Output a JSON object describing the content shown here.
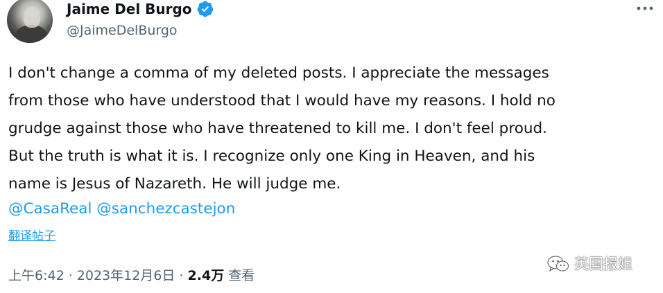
{
  "author": {
    "display_name": "Jaime Del Burgo",
    "handle": "@JaimeDelBurgo",
    "verified": true,
    "verified_color": "#1d9bf0"
  },
  "tweet": {
    "lines": [
      "I don't change a comma of my deleted posts. I appreciate the messages",
      "from those who have understood that I would have my reasons. I hold no",
      "grudge against those who have threatened to kill me. I don't feel proud.",
      "But the truth is what it is. I recognize only one King in Heaven, and his",
      "name is Jesus of Nazareth. He will judge me."
    ],
    "mentions": [
      "@CasaReal",
      "@sanchezcastejon"
    ],
    "translate_label": "翻译帖子"
  },
  "meta": {
    "time": "上午6:42",
    "separator": " · ",
    "date": "2023年12月6日",
    "views_count": "2.4万",
    "views_label": " 查看"
  },
  "watermark": {
    "text": "英国报姐",
    "icon": "wechat-icon"
  },
  "icons": {
    "more": "more-icon",
    "verified": "verified-badge-icon"
  },
  "colors": {
    "link": "#1d9bf0",
    "secondary_text": "#536471",
    "primary_text": "#0f1419"
  }
}
